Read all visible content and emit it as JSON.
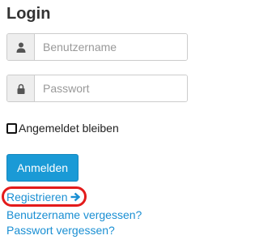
{
  "login": {
    "title": "Login",
    "username": {
      "placeholder": "Benutzername",
      "value": "",
      "icon": "user-icon"
    },
    "password": {
      "placeholder": "Passwort",
      "value": "",
      "icon": "lock-icon"
    },
    "remember_label": "Angemeldet bleiben",
    "remember_checked": false,
    "submit_label": "Anmelden"
  },
  "links": {
    "register": "Registrieren",
    "register_icon": "arrow-right-icon",
    "forgot_username": "Benutzername vergessen?",
    "forgot_password": "Passwort vergessen?"
  },
  "colors": {
    "primary": "#1a9ad6",
    "link": "#1a8fd3",
    "highlight": "#e31b1b"
  }
}
